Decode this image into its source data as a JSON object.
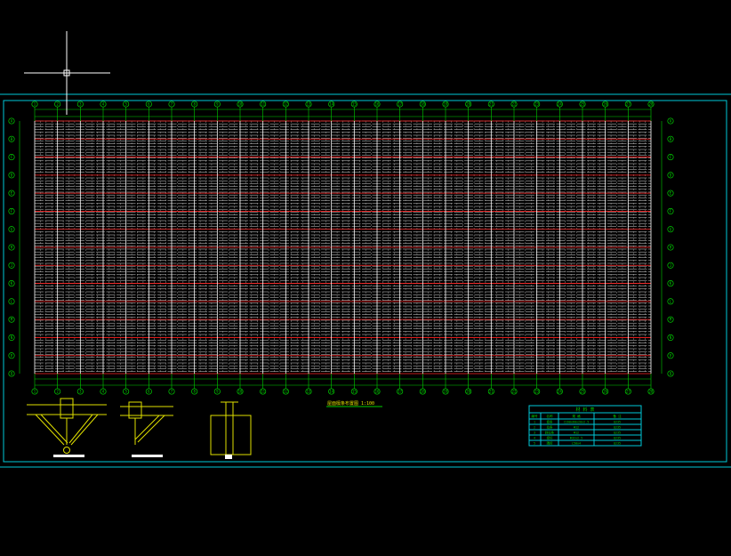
{
  "theme": {
    "background": "#000000",
    "frame": "#00c8d8",
    "grid_green": "#00d000",
    "axis_red": "#ff2020",
    "member_white": "#e6e6e6",
    "detail_yellow": "#e0e000",
    "cursor": "#ffffff"
  },
  "plan": {
    "columns": [
      "1",
      "2",
      "3",
      "4",
      "5",
      "6",
      "7",
      "8",
      "9",
      "10",
      "11",
      "12",
      "13",
      "14",
      "15",
      "16",
      "17",
      "18",
      "19",
      "20",
      "21",
      "22",
      "23",
      "24",
      "25",
      "26",
      "27",
      "28"
    ],
    "rows": [
      "A",
      "B",
      "C",
      "D",
      "E",
      "F",
      "G",
      "H",
      "J",
      "K",
      "L",
      "M",
      "N",
      "P",
      "Q"
    ]
  },
  "details": {
    "section_caption": "屋面檩条布置图 1:100"
  },
  "material_table": {
    "title": "材 料 表",
    "headers": [
      "编号",
      "名称",
      "规 格",
      "备 注"
    ],
    "rows": [
      [
        "1",
        "檩条",
        "C160x60x20x2.5",
        "Q235"
      ],
      [
        "2",
        "拉条",
        "Φ12",
        "Q235"
      ],
      [
        "3",
        "斜拉条",
        "Φ12",
        "Q235"
      ],
      [
        "4",
        "撑杆",
        "Φ32x2.5",
        "Q235"
      ],
      [
        "5",
        "隅撑",
        "L50x4",
        "Q235"
      ]
    ]
  }
}
